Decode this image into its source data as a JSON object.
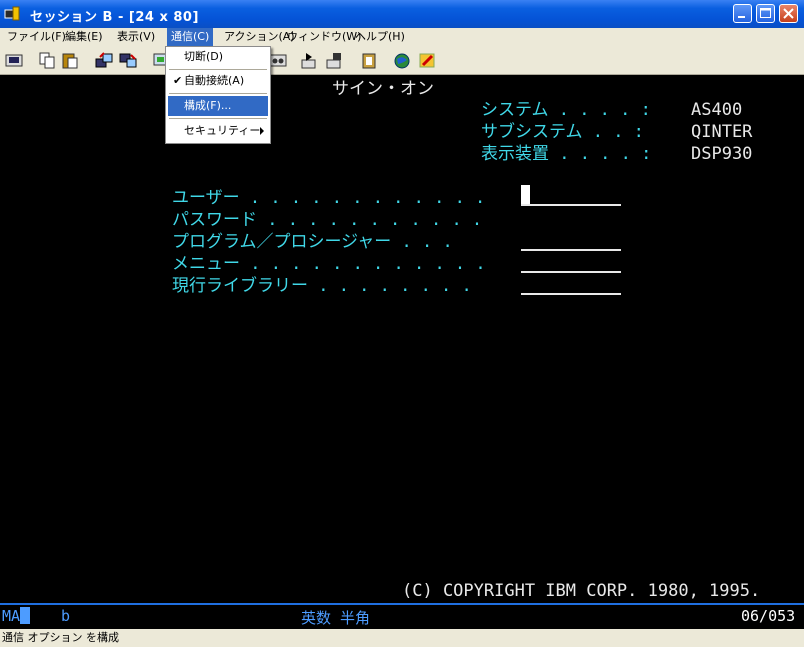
{
  "window": {
    "title": "セッション B - [24 x 80]",
    "title_color": "#ffffff",
    "titlebar_color": "#0553d6"
  },
  "menubar": {
    "items": [
      {
        "label": "ファイル(F)"
      },
      {
        "label": "編集(E)"
      },
      {
        "label": "表示(V)"
      },
      {
        "label": "通信(C)"
      },
      {
        "label": "アクション(A)"
      },
      {
        "label": "ウィンドウ(W)"
      },
      {
        "label": "ヘルプ(H)"
      }
    ]
  },
  "dropdown": {
    "items": [
      {
        "label": "切断(D)"
      },
      {
        "label": "自動接続(A)",
        "checked": "✔"
      },
      {
        "label": "構成(F)..."
      },
      {
        "label": "セキュリティー(S)"
      }
    ]
  },
  "toolbar": {
    "icons": [
      "print-screen-icon",
      "copy-icon",
      "paste-icon",
      "send-icon",
      "receive-icon",
      "display-icon",
      "record-icon",
      "play-icon",
      "macro-icon",
      "clipboard-icon",
      "globe-icon",
      "edit-icon"
    ]
  },
  "screen": {
    "title": "サイン・オン",
    "system_label": "システム . . . . :",
    "system_value": "AS400",
    "subsystem_label": "サブシステム . . :",
    "subsystem_value": "QINTER",
    "display_label": "表示装置 . . . . :",
    "display_value": "DSP930",
    "user_label": "ユーザー . . . . . . . . . . . .",
    "password_label": "パスワード . . . . . . . . . . .",
    "program_label": "プログラム／プロシージャー . . .",
    "menu_label": "メニュー . . . . . . . . . . . .",
    "library_label": "現行ライブラリー . . . . . . . .",
    "copyright": "(C) COPYRIGHT IBM CORP. 1980, 1995.",
    "label_color": "#40d8e8",
    "value_color": "#e8e8e8"
  },
  "oia": {
    "mode": "MA",
    "session": "b",
    "input_mode": "英数 半角",
    "cursor_pos": "06/053",
    "color": "#4d9cff"
  },
  "statusbar": {
    "text": "通信 オプション を構成"
  }
}
